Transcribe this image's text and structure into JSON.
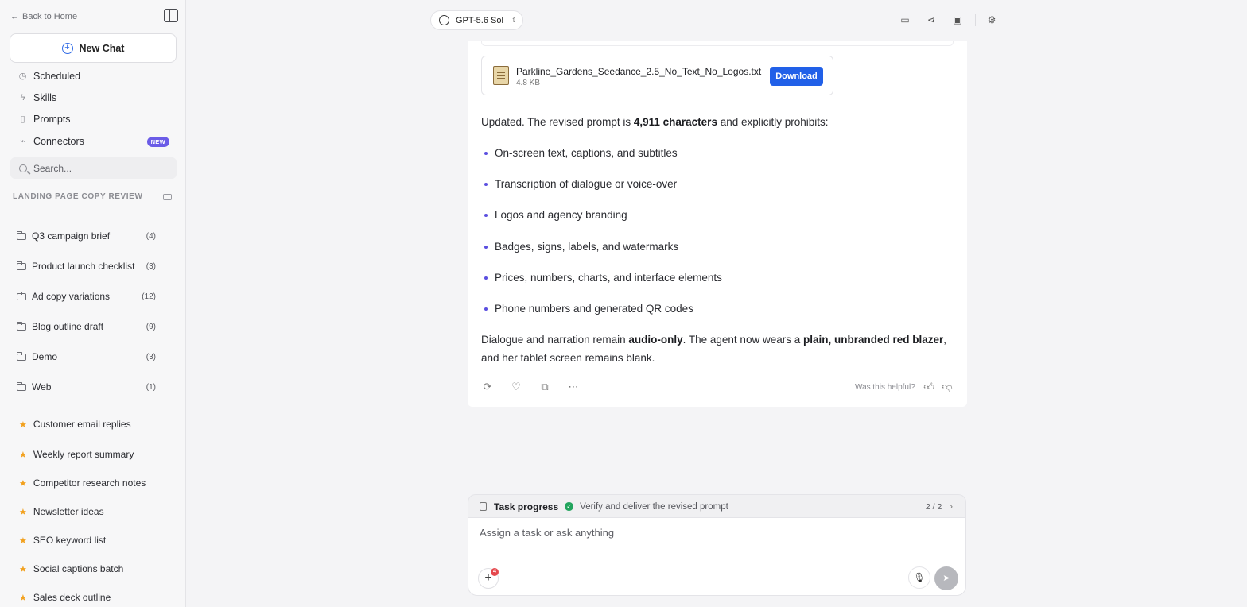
{
  "sidebar": {
    "back_label": "Back to Home",
    "new_chat_label": "New Chat",
    "nav": [
      {
        "label": "Scheduled",
        "icon": "clock-icon"
      },
      {
        "label": "Skills",
        "icon": "bolt-icon"
      },
      {
        "label": "Prompts",
        "icon": "book-icon"
      },
      {
        "label": "Connectors",
        "icon": "plug-icon",
        "badge": "NEW"
      }
    ],
    "search_placeholder": "Search...",
    "section_title": "LANDING PAGE COPY REVIEW",
    "folders": [
      {
        "name": "Q3 campaign brief",
        "count": "(4)"
      },
      {
        "name": "Product launch checklist",
        "count": "(3)"
      },
      {
        "name": "Ad copy variations",
        "count": "(12)"
      },
      {
        "name": "Blog outline draft",
        "count": "(9)"
      },
      {
        "name": "Demo",
        "count": "(3)"
      },
      {
        "name": "Web",
        "count": "(1)"
      }
    ],
    "starred": [
      "Customer email replies",
      "Weekly report summary",
      "Competitor research notes",
      "Newsletter ideas",
      "SEO keyword list",
      "Social captions batch",
      "Sales deck outline"
    ]
  },
  "topbar": {
    "model_label": "GPT-5.6 Sol"
  },
  "message": {
    "file": {
      "name": "Parkline_Gardens_Seedance_2.5_No_Text_No_Logos.txt",
      "size": "4.8 KB",
      "download_label": "Download"
    },
    "intro_pre": "Updated. The revised prompt is ",
    "intro_bold": "4,911 characters",
    "intro_post": " and explicitly prohibits:",
    "bullets": [
      "On-screen text, captions, and subtitles",
      "Transcription of dialogue or voice-over",
      "Logos and agency branding",
      "Badges, signs, labels, and watermarks",
      "Prices, numbers, charts, and interface elements",
      "Phone numbers and generated QR codes"
    ],
    "outro_1": "Dialogue and narration remain ",
    "outro_bold_1": "audio-only",
    "outro_2": ". The agent now wears a ",
    "outro_bold_2": "plain, unbranded red blazer",
    "outro_3": ",",
    "outro_line2": "and her tablet screen remains blank.",
    "helpful_label": "Was this helpful?"
  },
  "task_progress": {
    "title": "Task progress",
    "step": "Verify and deliver the revised prompt",
    "count": "2 / 2"
  },
  "composer": {
    "placeholder": "Assign a task or ask anything",
    "attachment_count": "4"
  },
  "colors": {
    "accent": "#2160e8",
    "bullet": "#5b4fe0",
    "success": "#22a45d",
    "star": "#f2a11e",
    "new_badge": "#6b5ce7"
  }
}
